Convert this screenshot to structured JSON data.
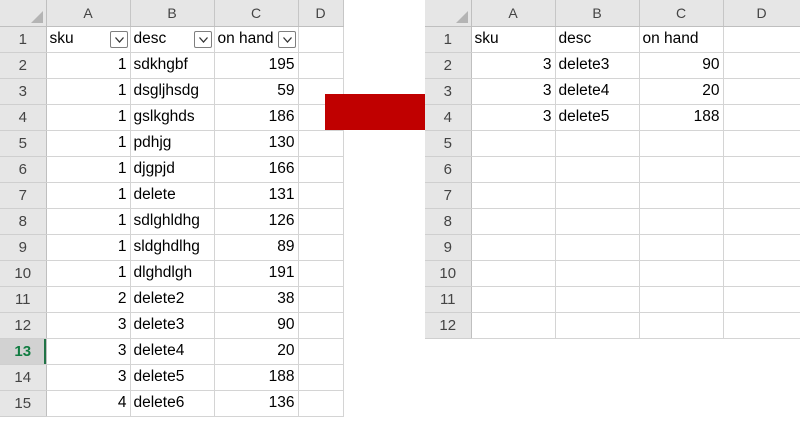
{
  "left_sheet": {
    "columns": [
      "A",
      "B",
      "C",
      "D"
    ],
    "headers": [
      "sku",
      "desc",
      "on hand"
    ],
    "filters_enabled": true,
    "selected_row": "13",
    "rows": [
      {
        "row": "1",
        "a": "sku",
        "b": "desc",
        "c": "on hand",
        "header": true
      },
      {
        "row": "2",
        "a": "1",
        "b": "sdkhgbf",
        "c": "195"
      },
      {
        "row": "3",
        "a": "1",
        "b": "dsgljhsdg",
        "c": "59"
      },
      {
        "row": "4",
        "a": "1",
        "b": "gslkghds",
        "c": "186"
      },
      {
        "row": "5",
        "a": "1",
        "b": "pdhjg",
        "c": "130"
      },
      {
        "row": "6",
        "a": "1",
        "b": "djgpjd",
        "c": "166"
      },
      {
        "row": "7",
        "a": "1",
        "b": "delete",
        "c": "131"
      },
      {
        "row": "8",
        "a": "1",
        "b": "sdlghldhg",
        "c": "126"
      },
      {
        "row": "9",
        "a": "1",
        "b": "sldghdlhg",
        "c": "89"
      },
      {
        "row": "10",
        "a": "1",
        "b": "dlghdlgh",
        "c": "191"
      },
      {
        "row": "11",
        "a": "2",
        "b": "delete2",
        "c": "38"
      },
      {
        "row": "12",
        "a": "3",
        "b": "delete3",
        "c": "90"
      },
      {
        "row": "13",
        "a": "3",
        "b": "delete4",
        "c": "20"
      },
      {
        "row": "14",
        "a": "3",
        "b": "delete5",
        "c": "188"
      },
      {
        "row": "15",
        "a": "4",
        "b": "delete6",
        "c": "136"
      }
    ]
  },
  "right_sheet": {
    "columns": [
      "A",
      "B",
      "C",
      "D"
    ],
    "rows": [
      {
        "row": "1",
        "a": "sku",
        "b": "desc",
        "c": "on hand",
        "header": true
      },
      {
        "row": "2",
        "a": "3",
        "b": "delete3",
        "c": "90"
      },
      {
        "row": "3",
        "a": "3",
        "b": "delete4",
        "c": "20"
      },
      {
        "row": "4",
        "a": "3",
        "b": "delete5",
        "c": "188"
      },
      {
        "row": "5",
        "a": "",
        "b": "",
        "c": ""
      },
      {
        "row": "6",
        "a": "",
        "b": "",
        "c": ""
      },
      {
        "row": "7",
        "a": "",
        "b": "",
        "c": ""
      },
      {
        "row": "8",
        "a": "",
        "b": "",
        "c": ""
      },
      {
        "row": "9",
        "a": "",
        "b": "",
        "c": ""
      },
      {
        "row": "10",
        "a": "",
        "b": "",
        "c": ""
      },
      {
        "row": "11",
        "a": "",
        "b": "",
        "c": ""
      },
      {
        "row": "12",
        "a": "",
        "b": "",
        "c": ""
      }
    ]
  },
  "arrow": {
    "icon": "right-arrow-icon",
    "color": "#c00000"
  },
  "colors": {
    "header_bg": "#e6e6e6",
    "selected_row_text": "#107c41",
    "gridline": "#d4d4d4"
  }
}
